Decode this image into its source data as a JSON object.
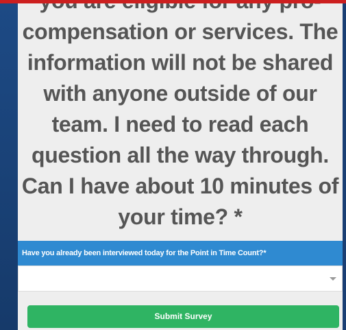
{
  "question": {
    "lines": [
      "you are eligible for any pro-",
      "compensation or services. The",
      "information will not be shared",
      "with anyone outside of our",
      "team. I need to read each",
      "question all the way through.",
      "Can I have about 10 minutes of",
      "your time? *"
    ]
  },
  "next_question": {
    "label": "Have you already been interviewed today for the Point in Time Count?*",
    "select_value": "",
    "dropdown_icon": "chevron-down-icon"
  },
  "submit": {
    "label": "Submit Survey"
  },
  "colors": {
    "background_blue": "#1b3f73",
    "top_bar_red": "#cc1f1f",
    "panel": "#eeeeee",
    "question_text": "#555555",
    "header_blue": "#2f8ad1",
    "submit_green": "#2fb463"
  }
}
